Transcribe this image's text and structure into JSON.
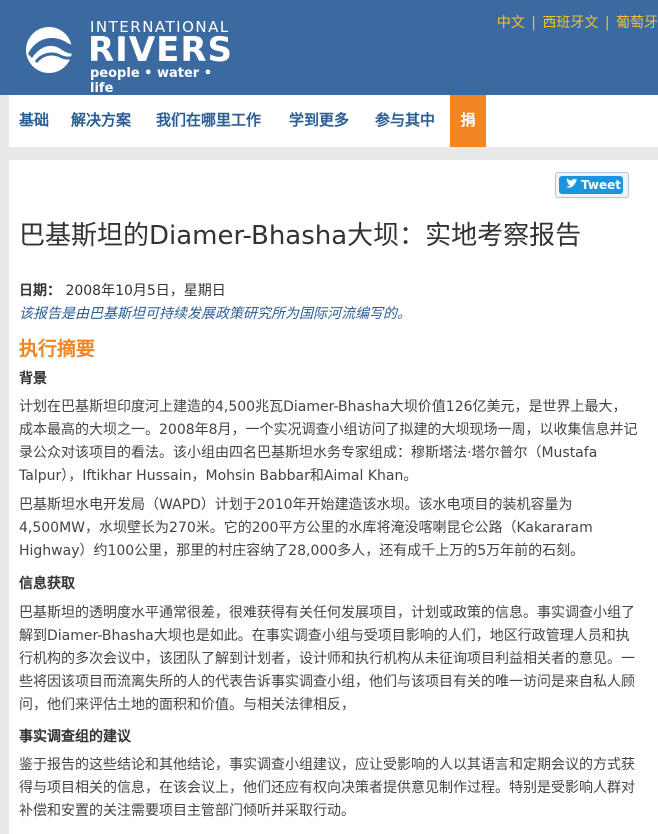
{
  "header": {
    "logo_top": "INTERNATIONAL",
    "logo_main": "RIVERS",
    "logo_tagline": "people • water • life",
    "languages": [
      "中文",
      "西班牙文",
      "葡萄牙"
    ],
    "lang_separator": "|"
  },
  "nav": {
    "items": [
      "基础",
      "解决方案",
      "我们在哪里工作",
      "学到更多",
      "参与其中"
    ],
    "donate": "捐"
  },
  "tweet": {
    "label": "Tweet"
  },
  "article": {
    "title": "巴基斯坦的Diamer-Bhasha大坝：实地考察报告",
    "date_label": "日期：",
    "date_value": "2008年10月5日，星期日",
    "credit": {
      "prefix": "该",
      "report_link": "报告",
      "middle": "是由巴基斯坦",
      "institute_link": "可持续发展政策研究所",
      "suffix": "为国际河流编写的。"
    },
    "exec_heading": "执行摘要",
    "sections": [
      {
        "heading": "背景",
        "paragraphs": [
          "计划在巴基斯坦印度河上建造的4,500兆瓦Diamer-Bhasha大坝价值126亿美元，是世界上最大，成本最高的大坝之一。2008年8月，一个实况调查小组访问了拟建的大坝现场一周，以收集信息并记录公众对该项目的看法。该小组由四名巴基斯坦水务专家组成：穆斯塔法·塔尔普尔（Mustafa Talpur），Iftikhar Hussain，Mohsin Babbar和Aimal Khan。",
          "巴基斯坦水电开发局（WAPD）计划于2010年开始建造该水坝。该水电项目的装机容量为4,500MW，水坝壁长为270米。它的200平方公里的水库将淹没喀喇昆仑公路（Kakararam Highway）约100公里，那里的村庄容纳了28,000多人，还有成千上万的5万年前的石刻。"
        ]
      },
      {
        "heading": "信息获取",
        "paragraphs": [
          "巴基斯坦的透明度水平通常很差，很难获得有关任何发展项目，计划或政策的信息。事实调查小组了解到Diamer-Bhasha大坝也是如此。在事实调查小组与受项目影响的人们，地区行政管理人员和执行机构的多次会议中，该团队了解到计划者，设计师和执行机构从未征询项目利益相关者的意见。一些将因该项目而流离失所的人的代表告诉事实调查小组，他们与该项目有关的唯一访问是来自私人顾问，他们来评估土地的面积和价值。与相关法律相反，"
        ]
      },
      {
        "heading": "事实调查组的建议",
        "paragraphs": [
          "鉴于报告的这些结论和其他结论，事实调查小组建议，应让受影响的人以其语言和定期会议的方式获得与项目相关的信息，在该会议上，他们还应有权向决策者提供意见制作过程。特别是受影响人群对补偿和安置的关注需要项目主管部门倾听并采取行动。"
        ]
      }
    ]
  }
}
